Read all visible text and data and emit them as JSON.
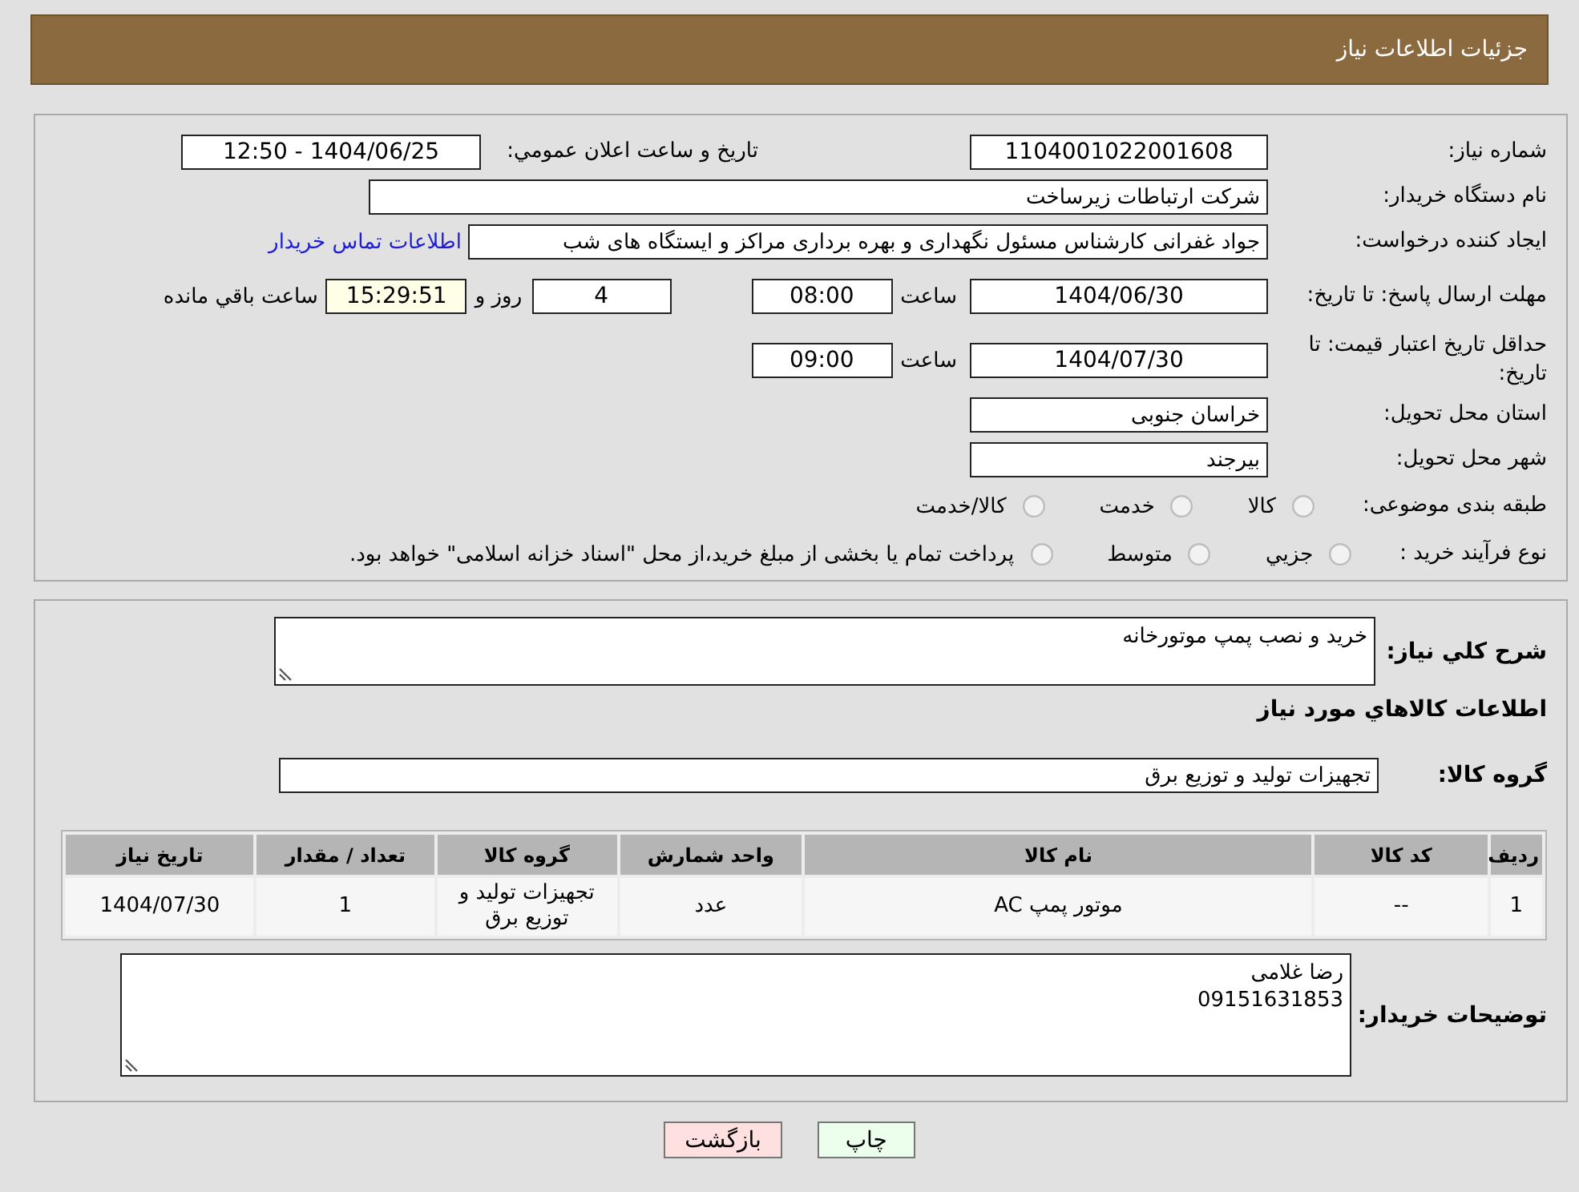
{
  "header": {
    "title": "جزئیات اطلاعات نیاز"
  },
  "details": {
    "need_number": {
      "label": "شماره نیاز:",
      "value": "1104001022001608"
    },
    "announcement": {
      "label": "تاريخ و ساعت اعلان عمومي:",
      "value": "1404/06/25 - 12:50"
    },
    "buyer_org": {
      "label": "نام دستگاه خريدار:",
      "value": "شرکت ارتباطات زیرساخت"
    },
    "requester": {
      "label": "ایجاد کننده درخواست:",
      "value": "جواد غفرانی کارشناس مسئول نگهداری و بهره برداری مراکز و ایستگاه های شب",
      "link": "اطلاعات تماس خریدار"
    },
    "reply_deadline": {
      "label": "مهلت ارسال پاسخ: تا تاریخ:",
      "date": "1404/06/30",
      "time_label": "ساعت",
      "time": "08:00",
      "days": "4",
      "days_label": "روز و",
      "remaining": "15:29:51",
      "remaining_label": "ساعت باقي مانده"
    },
    "price_validity": {
      "label": "حداقل تاریخ اعتبار قیمت: تا تاریخ:",
      "date": "1404/07/30",
      "time_label": "ساعت",
      "time": "09:00"
    },
    "delivery_province": {
      "label": "استان محل تحویل:",
      "value": "خراسان جنوبی"
    },
    "delivery_city": {
      "label": "شهر محل تحویل:",
      "value": "بیرجند"
    },
    "category": {
      "label": "طبقه بندی موضوعی:",
      "options": [
        {
          "label": "کالا",
          "selected": false
        },
        {
          "label": "خدمت",
          "selected": false
        },
        {
          "label": "کالا/خدمت",
          "selected": false
        }
      ]
    },
    "purchase_process": {
      "label": "نوع فرآیند خرید :",
      "options": [
        {
          "label": "جزيي",
          "selected": false
        },
        {
          "label": "متوسط",
          "selected": false
        },
        {
          "label": "پرداخت تمام یا بخشی از مبلغ خرید،از محل \"اسناد خزانه اسلامی\" خواهد بود.",
          "selected": false
        }
      ]
    }
  },
  "items": {
    "summary": {
      "label": "شرح کلي نياز:",
      "value": "خرید و نصب پمپ موتورخانه"
    },
    "heading": "اطلاعات کالاهاي مورد نياز",
    "goods_group": {
      "label": "گروه کالا:",
      "value": "تجهیزات تولید و توزیع برق"
    },
    "table": {
      "columns": [
        "رديف",
        "کد کالا",
        "نام کالا",
        "واحد شمارش",
        "گروه کالا",
        "تعداد / مقدار",
        "تاريخ نياز"
      ],
      "rows": [
        [
          "1",
          "--",
          "موتور پمپ AC",
          "عدد",
          "تجهیزات تولید و توزیع برق",
          "1",
          "1404/07/30"
        ]
      ]
    },
    "buyer_notes": {
      "label": "توضیحات خریدار:",
      "lines": [
        "رضا غلامی",
        "09151631853"
      ]
    }
  },
  "buttons": [
    {
      "label": "چاپ",
      "kind": "print"
    },
    {
      "label": "بازگشت",
      "kind": "back"
    }
  ]
}
